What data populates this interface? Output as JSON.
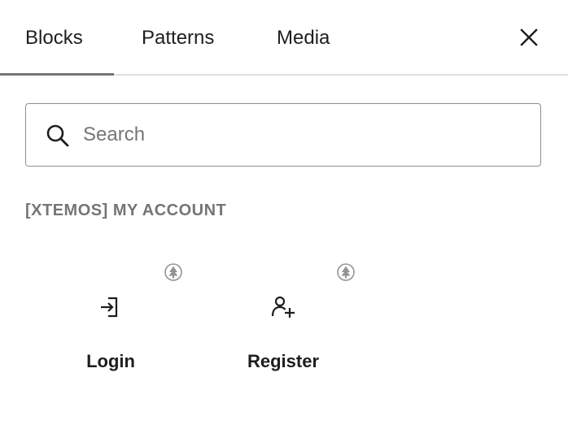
{
  "tabs": [
    {
      "label": "Blocks",
      "active": true
    },
    {
      "label": "Patterns",
      "active": false
    },
    {
      "label": "Media",
      "active": false
    }
  ],
  "close_icon": "close-icon",
  "search": {
    "placeholder": "Search",
    "value": "",
    "icon": "search-icon"
  },
  "category": {
    "title": "[XTEMOS] MY ACCOUNT"
  },
  "blocks": [
    {
      "label": "Login",
      "icon": "login-icon",
      "badge_icon": "tree-badge-icon"
    },
    {
      "label": "Register",
      "icon": "add-user-icon",
      "badge_icon": "tree-badge-icon"
    }
  ],
  "colors": {
    "text": "#1e1e1e",
    "muted": "#757575",
    "border": "#8c8f94",
    "divider": "#e0e0e0"
  }
}
